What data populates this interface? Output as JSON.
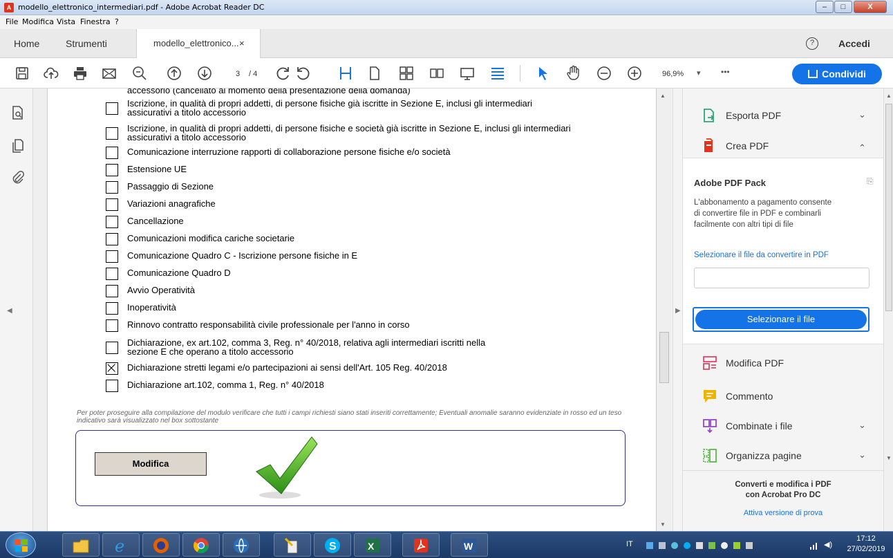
{
  "window": {
    "title": "modello_elettronico_intermediari.pdf - Adobe Acrobat Reader DC",
    "min_label": "–",
    "max_label": "□",
    "close_label": "X"
  },
  "menu": [
    "File",
    "Modifica",
    "Vista",
    "Finestra",
    "?"
  ],
  "tabs": {
    "home": "Home",
    "tools": "Strumenti",
    "doc": "modello_elettronico...",
    "doc_close": "×",
    "help": "?",
    "signin": "Accedi"
  },
  "toolbar": {
    "page_current": "3",
    "page_total": "/ 4",
    "zoom": "96,9%",
    "zoom_caret": "▾",
    "more": "•••",
    "share": "Condividi"
  },
  "document": {
    "cut_top": "accessorio (cancellato al momento della presentazione della domanda)",
    "items": [
      {
        "lines": [
          "Iscrizione, in qualità di propri addetti,  di persone fisiche già iscritte in Sezione E, inclusi gli intermediari",
          "assicurativi a titolo accessorio"
        ],
        "checked": false
      },
      {
        "lines": [
          "Iscrizione, in qualità di propri addetti,  di persone fisiche e società già iscritte in Sezione E, inclusi gli intermediari",
          "assicurativi a titolo accessorio"
        ],
        "checked": false
      },
      {
        "lines": [
          "Comunicazione interruzione rapporti di collaborazione persone fisiche e/o società"
        ],
        "checked": false
      },
      {
        "lines": [
          "Estensione UE"
        ],
        "checked": false
      },
      {
        "lines": [
          "Passaggio di Sezione"
        ],
        "checked": false
      },
      {
        "lines": [
          "Variazioni anagrafiche"
        ],
        "checked": false
      },
      {
        "lines": [
          "Cancellazione"
        ],
        "checked": false
      },
      {
        "lines": [
          "Comunicazioni modifica cariche societarie"
        ],
        "checked": false
      },
      {
        "lines": [
          "Comunicazione Quadro C - Iscrizione persone fisiche in E"
        ],
        "checked": false
      },
      {
        "lines": [
          "Comunicazione  Quadro D"
        ],
        "checked": false
      },
      {
        "lines": [
          "Avvio Operatività"
        ],
        "checked": false
      },
      {
        "lines": [
          "Inoperatività"
        ],
        "checked": false
      },
      {
        "lines": [
          "Rinnovo contratto responsabilità civile professionale per l'anno in corso"
        ],
        "checked": false
      },
      {
        "lines": [
          "Dichiarazione, ex art.102, comma 3, Reg. n° 40/2018, relativa agli intermediari iscritti nella",
          "sezione E che operano a titolo accessorio"
        ],
        "checked": false
      },
      {
        "lines": [
          "Dichiarazione stretti legami e/o partecipazioni ai sensi dell'Art. 105 Reg. 40/2018"
        ],
        "checked": true
      },
      {
        "lines": [
          "Dichiarazione art.102, comma 1, Reg. n° 40/2018"
        ],
        "checked": false
      }
    ],
    "note": "Per poter proseguire alla compilazione del modulo verificare che tutti i campi richiesti siano stati inseriti correttamente; Eventuali anomalie saranno evidenziate in rosso ed un teso indicativo sarà visualizzato nel box sottostante",
    "modifica": "Modifica"
  },
  "panel": {
    "export": "Esporta PDF",
    "create": "Crea PDF",
    "pack_title": "Adobe PDF Pack",
    "pack_desc": [
      "L'abbonamento a pagamento consente",
      "di convertire file in PDF e combinarli",
      "facilmente con altri tipi di file"
    ],
    "select_link": "Selezionare il file da convertire in PDF",
    "select_button": "Selezionare il file",
    "edit": "Modifica PDF",
    "comment": "Commento",
    "combine": "Combinate i file",
    "organize": "Organizza pagine",
    "promo": [
      "Converti e modifica i PDF",
      "con Acrobat Pro DC"
    ],
    "trial": "Attiva versione di prova",
    "colors": {
      "accent": "#1473e6",
      "export": "#2fa57a",
      "create": "#e0341f",
      "edit": "#e0486b",
      "comment": "#f0b400",
      "combine": "#9346d1",
      "organize": "#5bb84b"
    }
  },
  "taskbar": {
    "lang": "IT",
    "time": "17:12",
    "date": "27/02/2019"
  }
}
